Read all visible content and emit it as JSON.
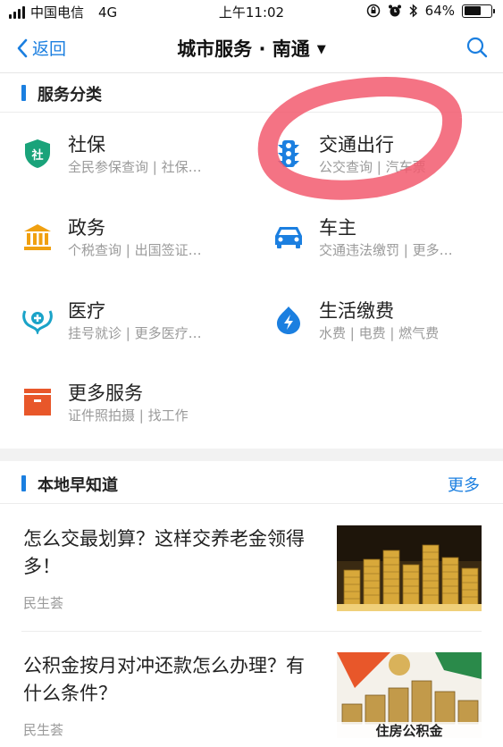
{
  "status_bar": {
    "carrier": "中国电信",
    "network": "4G",
    "time": "上午11:02",
    "battery_text": "64%",
    "battery_level": 0.64
  },
  "nav": {
    "back_label": "返回",
    "title": "城市服务 · 南通",
    "title_caret": "▼",
    "back_icon": "chevron-left-icon",
    "search_icon": "search-icon"
  },
  "services_section": {
    "label": "服务分类",
    "items": [
      {
        "name": "社保",
        "desc": "全民参保查询 | 社保…",
        "icon": "social-security-shield-icon",
        "icon_text": "社",
        "color": "#1aa37a"
      },
      {
        "name": "交通出行",
        "desc": "公交查询 | 汽车票",
        "icon": "traffic-light-icon",
        "color": "#1b7fe0"
      },
      {
        "name": "政务",
        "desc": "个税查询 | 出国签证…",
        "icon": "government-building-icon",
        "color": "#f0a010"
      },
      {
        "name": "车主",
        "desc": "交通违法缴罚 | 更多…",
        "icon": "car-icon",
        "color": "#1b7fe0"
      },
      {
        "name": "医疗",
        "desc": "挂号就诊 | 更多医疗…",
        "icon": "stethoscope-icon",
        "color": "#1aa3c8"
      },
      {
        "name": "生活缴费",
        "desc": "水费 | 电费 | 燃气费",
        "icon": "lightning-bolt-icon",
        "color": "#1b7fe0"
      },
      {
        "name": "更多服务",
        "desc": "证件照拍摄 | 找工作",
        "icon": "box-icon",
        "color": "#e8572a"
      }
    ]
  },
  "news_section": {
    "label": "本地早知道",
    "more_label": "更多",
    "articles": [
      {
        "title": "怎么交最划算？这样交养老金领得多！",
        "source": "民生荟",
        "thumb_icon": "gold-coins-image"
      },
      {
        "title": "公积金按月对冲还款怎么办理？有什么条件？",
        "source": "民生荟",
        "thumb_icon": "housing-fund-coins-image",
        "thumb_text": "住房公积金"
      }
    ]
  },
  "colors": {
    "accent": "#1b7fe0",
    "annotation": "#f25a6e"
  }
}
